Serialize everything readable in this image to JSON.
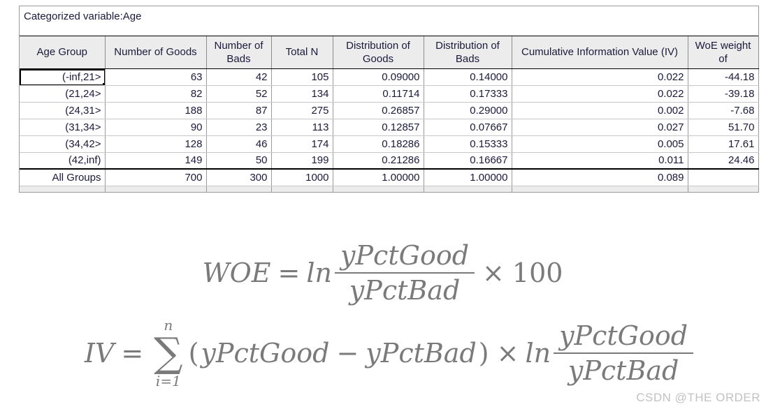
{
  "sheet": {
    "title": "Categorized variable:Age",
    "columns": [
      {
        "key": "group",
        "label": "Age Group"
      },
      {
        "key": "goods",
        "label": "Number of Goods"
      },
      {
        "key": "bads",
        "label": "Number of Bads"
      },
      {
        "key": "totaln",
        "label": "Total N"
      },
      {
        "key": "distg",
        "label": "Distribution of Goods"
      },
      {
        "key": "distb",
        "label": "Distribution of Bads"
      },
      {
        "key": "iv",
        "label": "Cumulative Information Value (IV)"
      },
      {
        "key": "woe",
        "label": "WoE weight of"
      }
    ],
    "rows": [
      {
        "group": "(-inf,21>",
        "goods": "63",
        "bads": "42",
        "totaln": "105",
        "distg": "0.09000",
        "distb": "0.14000",
        "iv": "0.022",
        "woe": "-44.18"
      },
      {
        "group": "(21,24>",
        "goods": "82",
        "bads": "52",
        "totaln": "134",
        "distg": "0.11714",
        "distb": "0.17333",
        "iv": "0.022",
        "woe": "-39.18"
      },
      {
        "group": "(24,31>",
        "goods": "188",
        "bads": "87",
        "totaln": "275",
        "distg": "0.26857",
        "distb": "0.29000",
        "iv": "0.002",
        "woe": "-7.68"
      },
      {
        "group": "(31,34>",
        "goods": "90",
        "bads": "23",
        "totaln": "113",
        "distg": "0.12857",
        "distb": "0.07667",
        "iv": "0.027",
        "woe": "51.70"
      },
      {
        "group": "(34,42>",
        "goods": "128",
        "bads": "46",
        "totaln": "174",
        "distg": "0.18286",
        "distb": "0.15333",
        "iv": "0.005",
        "woe": "17.61"
      },
      {
        "group": "(42,inf)",
        "goods": "149",
        "bads": "50",
        "totaln": "199",
        "distg": "0.21286",
        "distb": "0.16667",
        "iv": "0.011",
        "woe": "24.46"
      }
    ],
    "total_row": {
      "group": "All Groups",
      "goods": "700",
      "bads": "300",
      "totaln": "1000",
      "distg": "1.00000",
      "distb": "1.00000",
      "iv": "0.089",
      "woe": ""
    },
    "selected_cell": "(-inf,21>"
  },
  "formulas": {
    "woe": {
      "lhs": "WOE",
      "equals": "=",
      "ln": "ln",
      "numerator": "yPctGood",
      "denominator": "yPctBad",
      "times": "×",
      "factor": "100"
    },
    "iv": {
      "lhs": "IV",
      "equals": "=",
      "sum_sign": "∑",
      "sum_upper": "n",
      "sum_lower": "i=1",
      "open_paren": "(",
      "term_left": "yPctGood",
      "minus": "−",
      "term_right": "yPctBad",
      "close_paren": ")",
      "times": "×",
      "ln": "ln",
      "numerator": "yPctGood",
      "denominator": "yPctBad"
    }
  },
  "watermark": {
    "text": "CSDN @THE ORDER"
  },
  "colors": {
    "header_bg": "#ececec",
    "grid_line": "#9a9a9a",
    "text": "#1a1a3c",
    "formula_text": "#7a7a7a",
    "watermark_text": "#c2c2c2"
  }
}
